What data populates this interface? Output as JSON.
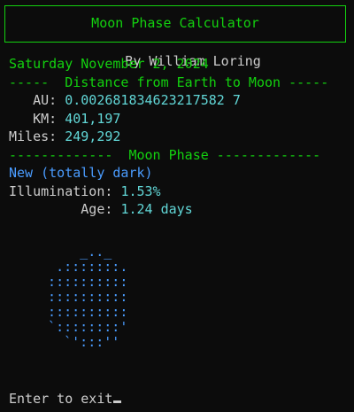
{
  "header": {
    "title": "Moon Phase Calculator",
    "author": "By William Loring"
  },
  "date": "Saturday November 2, 2024",
  "distance": {
    "section_header": "-----  Distance from Earth to Moon -----",
    "au_label": "AU:",
    "au_value": "0.002681834623217582 7",
    "km_label": "KM:",
    "km_value": "401,197",
    "miles_label": "Miles:",
    "miles_value": "249,292"
  },
  "phase": {
    "section_header": "-------------  Moon Phase -------------",
    "name": "New (totally dark)",
    "illumination_label": "Illumination:",
    "illumination_value": "1.53%",
    "age_label": "Age:",
    "age_value": "1.24",
    "age_unit": "days"
  },
  "moon_ascii": "      _.._\n   .:::::::.\n  ::::::::::\n  ::::::::::\n  ::::::::::\n  `::::::::'\n    `':::''",
  "prompt": "Enter to exit",
  "colors": {
    "green": "#13d10f",
    "cyan": "#61d6d6",
    "blue": "#4a9cff",
    "text": "#cccccc",
    "background": "#0c0c0c"
  }
}
